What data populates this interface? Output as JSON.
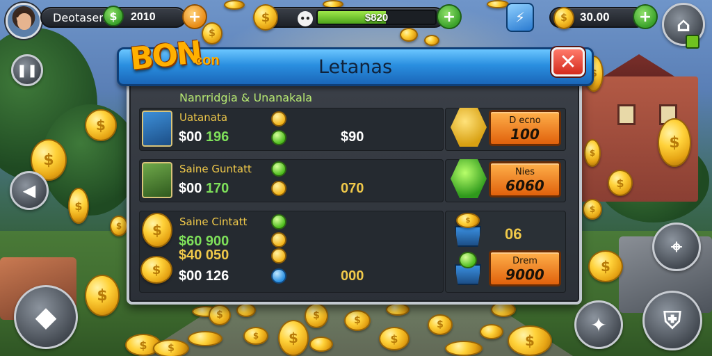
{
  "hud": {
    "player_name": "Deotasen",
    "gem_balance": "2010",
    "xp_bar_text": "$820",
    "xp_progress": 0.58,
    "coin_balance": "30.00"
  },
  "logo": {
    "main": "BON",
    "sub": "con"
  },
  "panel": {
    "title": "Letanas",
    "subtitle": "Nanrridgia & Unanakala",
    "close_label": "✕",
    "rows": [
      {
        "label": "Uatanata",
        "price_prefix": "$00",
        "price_value": "196",
        "value": "$90",
        "button_top": "D ecno",
        "button_bottom": "100"
      },
      {
        "label": "Saine Guntatt",
        "price_prefix": "$00",
        "price_value": "170",
        "value": "070",
        "button_top": "Nies",
        "button_bottom": "6060"
      },
      {
        "label": "Saine Cintatt",
        "lines": [
          {
            "text": "$60 900",
            "color": "green"
          },
          {
            "text": "$40 050",
            "color": "gold"
          },
          {
            "text": "$00 126",
            "color": "white"
          }
        ],
        "value": "000",
        "side_value": "06",
        "button_top": "Drem",
        "button_bottom": "9000"
      }
    ]
  },
  "colors": {
    "accent_gold": "#f0c94a",
    "accent_green": "#7ee05a",
    "header_blue": "#2a8fe0",
    "button_orange": "#e0610c",
    "close_red": "#d32a1c"
  }
}
